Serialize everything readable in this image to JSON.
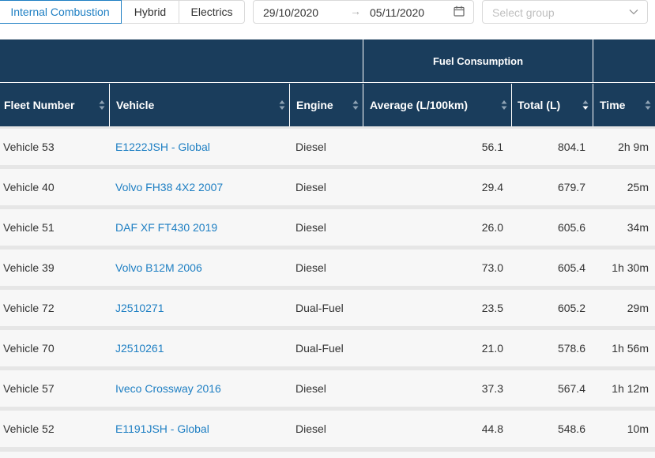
{
  "tabs": {
    "internal": "Internal Combustion",
    "hybrid": "Hybrid",
    "electrics": "Electrics"
  },
  "date_range": {
    "start": "29/10/2020",
    "arrow": "→",
    "end": "05/11/2020"
  },
  "group_select": {
    "placeholder": "Select group"
  },
  "table": {
    "group_header": "Fuel Consumption",
    "columns": {
      "fleet": "Fleet Number",
      "vehicle": "Vehicle",
      "engine": "Engine",
      "average": "Average (L/100km)",
      "total": "Total (L)",
      "time": "Time"
    },
    "rows": [
      {
        "fleet": "Vehicle 53",
        "vehicle": "E1222JSH - Global",
        "engine": "Diesel",
        "average": "56.1",
        "total": "804.1",
        "time": "2h 9m"
      },
      {
        "fleet": "Vehicle 40",
        "vehicle": "Volvo FH38 4X2 2007",
        "engine": "Diesel",
        "average": "29.4",
        "total": "679.7",
        "time": "25m"
      },
      {
        "fleet": "Vehicle 51",
        "vehicle": "DAF XF FT430 2019",
        "engine": "Diesel",
        "average": "26.0",
        "total": "605.6",
        "time": "34m"
      },
      {
        "fleet": "Vehicle 39",
        "vehicle": "Volvo B12M 2006",
        "engine": "Diesel",
        "average": "73.0",
        "total": "605.4",
        "time": "1h 30m"
      },
      {
        "fleet": "Vehicle 72",
        "vehicle": "J2510271",
        "engine": "Dual-Fuel",
        "average": "23.5",
        "total": "605.2",
        "time": "29m"
      },
      {
        "fleet": "Vehicle 70",
        "vehicle": "J2510261",
        "engine": "Dual-Fuel",
        "average": "21.0",
        "total": "578.6",
        "time": "1h 56m"
      },
      {
        "fleet": "Vehicle 57",
        "vehicle": "Iveco Crossway 2016",
        "engine": "Diesel",
        "average": "37.3",
        "total": "567.4",
        "time": "1h 12m"
      },
      {
        "fleet": "Vehicle 52",
        "vehicle": "E1191JSH - Global",
        "engine": "Diesel",
        "average": "44.8",
        "total": "548.6",
        "time": "10m"
      }
    ]
  },
  "colors": {
    "accent": "#1e7fc3",
    "header_bg": "#1a3d5c",
    "row_bg": "#f7f7f7",
    "row_separator": "#e6e6e6"
  },
  "icons": {
    "calendar": "calendar-icon",
    "chevron": "chevron-down-icon",
    "sorter": "sort-icon"
  },
  "sort": {
    "column": "total",
    "direction": "descending"
  }
}
